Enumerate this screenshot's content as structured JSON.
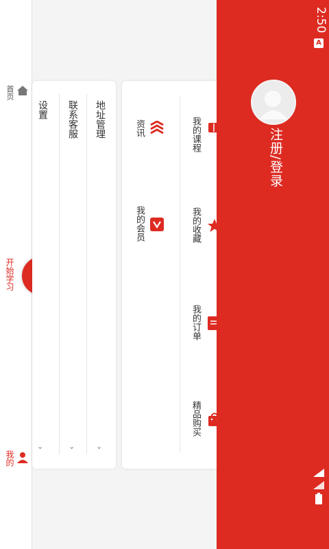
{
  "status": {
    "time": "2:50",
    "badge": "A"
  },
  "header": {
    "login": "注册/登录"
  },
  "card1": {
    "items": [
      {
        "label": "我的课程",
        "icon": "book-icon"
      },
      {
        "label": "我的收藏",
        "icon": "star-icon"
      },
      {
        "label": "我的订单",
        "icon": "order-icon"
      },
      {
        "label": "精品购买",
        "icon": "shopping-bag-icon"
      }
    ],
    "sub": [
      {
        "label": "资讯",
        "icon": "news-icon"
      },
      {
        "label": "我的会员",
        "icon": "vip-icon"
      }
    ]
  },
  "card2": {
    "items": [
      {
        "label": "地址管理"
      },
      {
        "label": "联系客服"
      },
      {
        "label": "设置"
      }
    ]
  },
  "nav": {
    "home": "首页",
    "study": "开始学习",
    "mine": "我的"
  },
  "colors": {
    "accent": "#dd2b22"
  }
}
